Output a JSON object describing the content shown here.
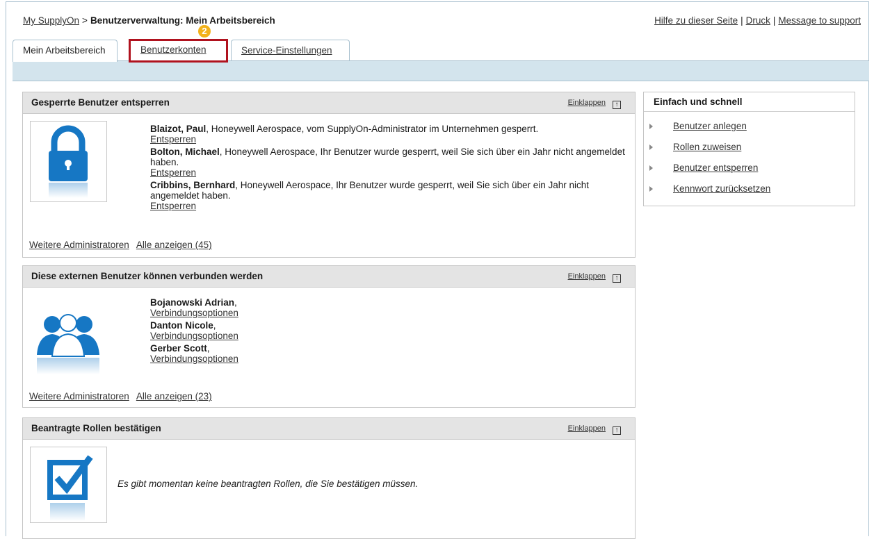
{
  "breadcrumb": {
    "root": "My SupplyOn",
    "separator": ">",
    "current": "Benutzerverwaltung: Mein Arbeitsbereich"
  },
  "top_links": [
    "Hilfe zu dieser Seite",
    "Druck",
    "Message to support"
  ],
  "tabs": [
    {
      "label": "Mein Arbeitsbereich",
      "active": true
    },
    {
      "label": "Benutzerkonten",
      "highlighted": true
    },
    {
      "label": "Service-Einstellungen"
    }
  ],
  "step_badge": "2",
  "panels": {
    "locked": {
      "title": "Gesperrte Benutzer entsperren",
      "collapse_label": "Einklappen",
      "entries": [
        {
          "name": "Blaizot, Paul",
          "text": ", Honeywell Aerospace, vom SupplyOn-Administrator im Unternehmen gesperrt.",
          "action": "Entsperren"
        },
        {
          "name": "Bolton, Michael",
          "text": ", Honeywell Aerospace, Ihr Benutzer wurde gesperrt, weil Sie sich über ein Jahr nicht angemeldet haben.",
          "action": "Entsperren"
        },
        {
          "name": "Cribbins, Bernhard",
          "text": ", Honeywell Aerospace, Ihr Benutzer wurde gesperrt, weil Sie sich über ein Jahr nicht angemeldet haben.",
          "action": "Entsperren"
        }
      ],
      "footer": {
        "more_admins": "Weitere Administratoren",
        "show_all": "Alle anzeigen (45)"
      }
    },
    "external": {
      "title": "Diese externen Benutzer können verbunden werden",
      "collapse_label": "Einklappen",
      "entries": [
        {
          "name": "Bojanowski Adrian",
          "text": ",",
          "action": "Verbindungsoptionen"
        },
        {
          "name": "Danton Nicole",
          "text": ",",
          "action": "Verbindungsoptionen"
        },
        {
          "name": "Gerber Scott",
          "text": ",",
          "action": "Verbindungsoptionen"
        }
      ],
      "footer": {
        "more_admins": "Weitere Administratoren",
        "show_all": "Alle anzeigen (23)"
      }
    },
    "roles": {
      "title": "Beantragte Rollen bestätigen",
      "collapse_label": "Einklappen",
      "empty_message": "Es gibt momentan keine beantragten Rollen, die Sie bestätigen müssen."
    }
  },
  "quick": {
    "title": "Einfach und schnell",
    "items": [
      "Benutzer anlegen",
      "Rollen zuweisen",
      "Benutzer entsperren",
      "Kennwort zurücksetzen"
    ]
  },
  "colors": {
    "accent_blue": "#1677c4",
    "highlight_red": "#b0121e",
    "badge_orange": "#f3b21b",
    "tabbar_blue": "#d3e4ed"
  }
}
